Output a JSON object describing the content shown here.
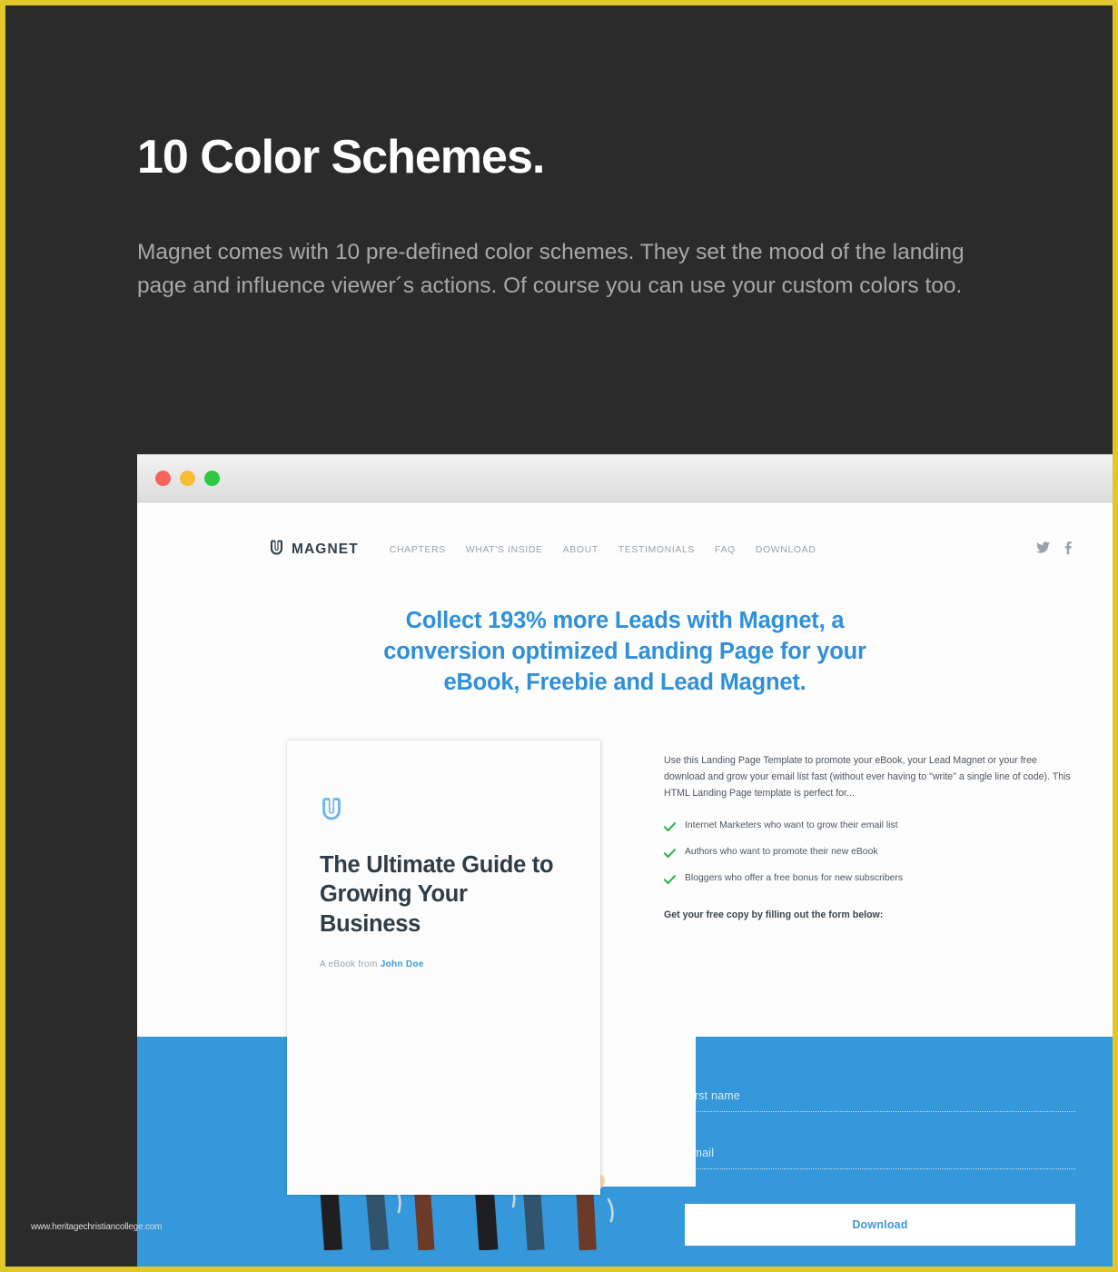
{
  "theme": {
    "frame_border_color": "#e0c72b",
    "stage_background": "#2b2b2b",
    "accent_blue": "#3498db",
    "headline_blue": "#2f90d8",
    "muted_text": "#a8a8a8",
    "check_green": "#2eb34a",
    "dark_ink": "#2f3d47"
  },
  "intro": {
    "title": "10 Color Schemes.",
    "body": "Magnet comes with 10 pre-defined color schemes. They set the mood of the landing page and influence viewer´s actions. Of course you can use your custom colors too."
  },
  "browser": {
    "window_controls": [
      {
        "name": "close",
        "color": "#f5655a"
      },
      {
        "name": "minimize",
        "color": "#f6bd35"
      },
      {
        "name": "maximize",
        "color": "#2ec942"
      }
    ]
  },
  "site": {
    "brand": "MAGNET",
    "brand_logo_icon": "magnet-icon",
    "nav": [
      "CHAPTERS",
      "WHAT'S INSIDE",
      "ABOUT",
      "TESTIMONIALS",
      "FAQ",
      "DOWNLOAD"
    ],
    "social": [
      {
        "icon": "twitter-icon",
        "label": "Twitter"
      },
      {
        "icon": "facebook-icon",
        "label": "Facebook"
      }
    ],
    "hero_headline": "Collect 193% more Leads with Magnet, a conversion optimized Landing Page for your eBook, Freebie and Lead Magnet.",
    "ebook": {
      "logo_icon": "magnet-icon",
      "title": "The Ultimate Guide to Growing Your Business",
      "author_prefix": "A eBook from ",
      "author_name": "John Doe"
    },
    "body_paragraph": "Use this Landing Page Template to promote your eBook, your Lead Magnet or your free download and grow your email list fast (without ever having to \"write\" a single line of code). This HTML Landing Page template is perfect for...",
    "checklist": [
      "Internet Marketers who want to grow their email list",
      "Authors who want to promote their new eBook",
      "Bloggers who offer a free bonus for new subscribers"
    ],
    "form_lead": "Get your free copy by filling out the form below:",
    "form": {
      "first_name": {
        "label": "First name",
        "value": "",
        "placeholder": "First name"
      },
      "email": {
        "label": "Email",
        "value": "",
        "placeholder": "Email"
      },
      "submit_label": "Download"
    }
  },
  "watermark": "www.heritagechristiancollege.com"
}
